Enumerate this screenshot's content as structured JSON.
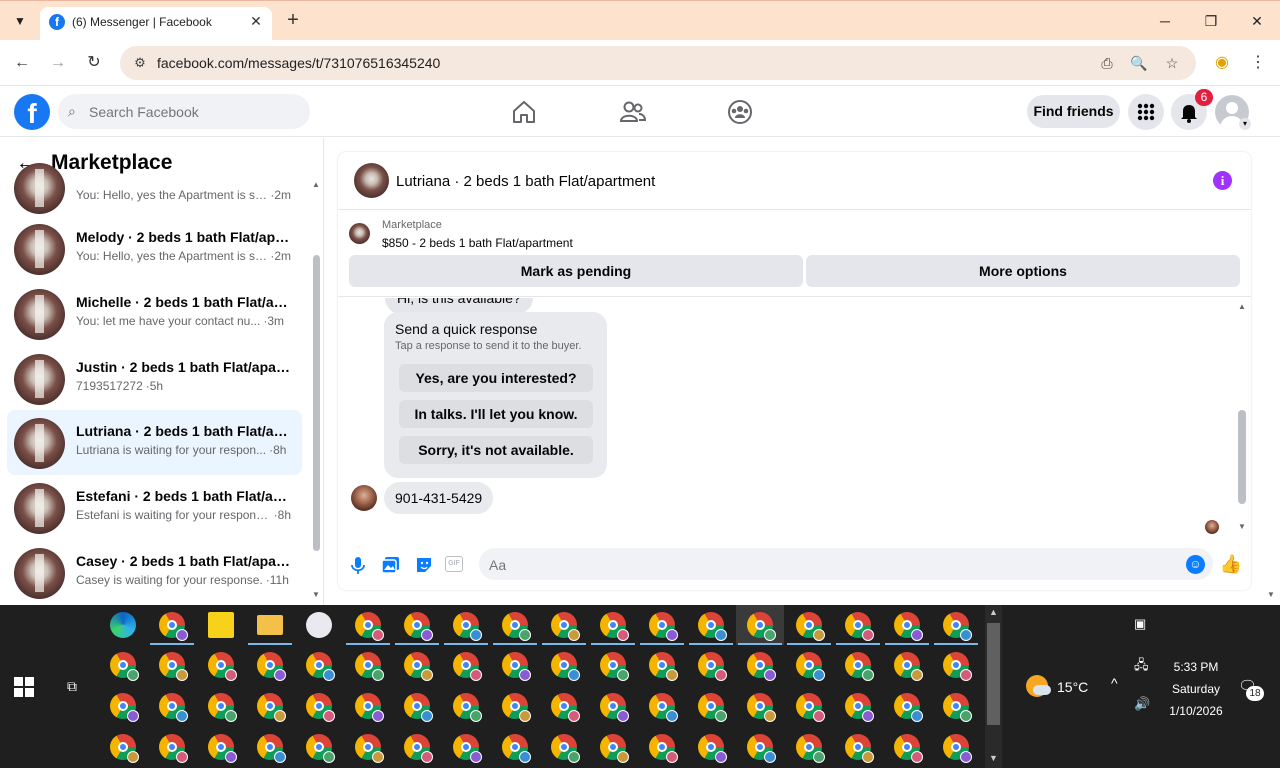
{
  "browser": {
    "tab_title": "(6) Messenger | Facebook",
    "url": "facebook.com/messages/t/731076516345240",
    "tab_icon": "facebook-icon",
    "window_controls": [
      "minimize-icon",
      "restore-icon",
      "close-icon"
    ]
  },
  "facebook": {
    "search_placeholder": "Search Facebook",
    "find_friends": "Find friends",
    "notification_count": "6",
    "nav_icons": [
      "home-icon",
      "friends-icon",
      "groups-icon"
    ]
  },
  "sidebar": {
    "title": "Marketplace",
    "conversations": [
      {
        "name": "",
        "preview": "You: Hello, yes the Apartment is sti...",
        "time": "2m",
        "active": false
      },
      {
        "name": "Melody · 2 beds 1 bath Flat/apar...",
        "preview": "You: Hello, yes the Apartment is sti...",
        "time": "2m",
        "active": false
      },
      {
        "name": "Michelle · 2 beds 1 bath Flat/apa...",
        "preview": "You: let me have your contact nu...",
        "time": "3m",
        "active": false
      },
      {
        "name": "Justin · 2 beds 1 bath Flat/apart...",
        "preview": "7193517272",
        "time": "5h",
        "active": false
      },
      {
        "name": "Lutriana · 2 beds 1 bath Flat/apa...",
        "preview": "Lutriana is waiting for your respon...",
        "time": "8h",
        "active": true
      },
      {
        "name": "Estefani · 2 beds 1 bath Flat/apa...",
        "preview": "Estefani is waiting for your response.",
        "time": "8h",
        "active": false
      },
      {
        "name": "Casey · 2 beds 1 bath Flat/apart...",
        "preview": "Casey is waiting for your response.",
        "time": "11h",
        "active": false
      }
    ]
  },
  "chat": {
    "title": "Lutriana · 2 beds 1 bath Flat/apartment",
    "marketplace_label": "Marketplace",
    "listing": "$850 - 2 beds 1 bath Flat/apartment",
    "mark_pending": "Mark as pending",
    "more_options": "More options",
    "previous_message": "Hi, is this available?",
    "quick_response": {
      "title": "Send a quick response",
      "subtitle": "Tap a response to send it to the buyer.",
      "options": [
        "Yes, are you interested?",
        "In talks. I'll let you know.",
        "Sorry, it's not available."
      ]
    },
    "received_message": "901-431-5429",
    "input_placeholder": "Aa",
    "composer_icons": [
      "microphone-icon",
      "photo-icon",
      "sticker-icon",
      "gif-icon",
      "emoji-icon",
      "thumbs-up-icon"
    ]
  },
  "taskbar": {
    "weather_temp": "15°C",
    "time": "5:33 PM",
    "day": "Saturday",
    "date": "1/10/2026",
    "notification_count": "18"
  }
}
